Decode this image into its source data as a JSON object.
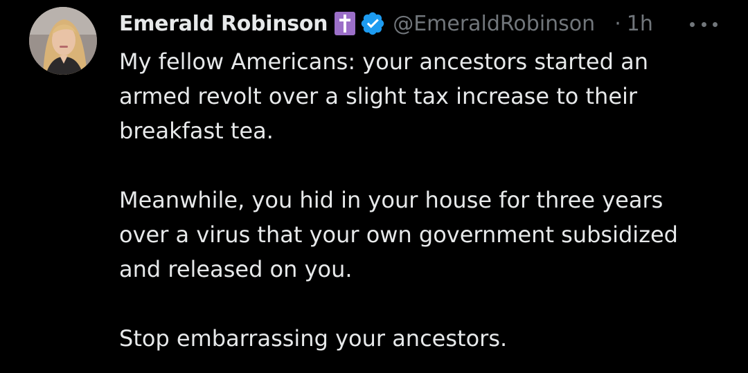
{
  "tweet": {
    "author": {
      "display_name": "Emerald Robinson",
      "badge_icon": "latin-cross-icon",
      "verified_icon": "verified-badge-icon",
      "handle": "@EmeraldRobinson",
      "timestamp": "1h",
      "separator": "·"
    },
    "more_icon": "more-horizontal-icon",
    "paragraphs": [
      "My fellow Americans: your ancestors started an\narmed revolt over a slight tax increase to their\nbreakfast tea.",
      "Meanwhile, you hid in your house for three years\nover a virus that your own government subsidized\nand released on you.",
      "Stop embarrassing your ancestors."
    ]
  },
  "colors": {
    "background": "#000000",
    "text_primary": "#e7e9ea",
    "text_secondary": "#71767b",
    "verified_blue": "#1d9bf0",
    "cross_badge": "#9b6fc8"
  }
}
